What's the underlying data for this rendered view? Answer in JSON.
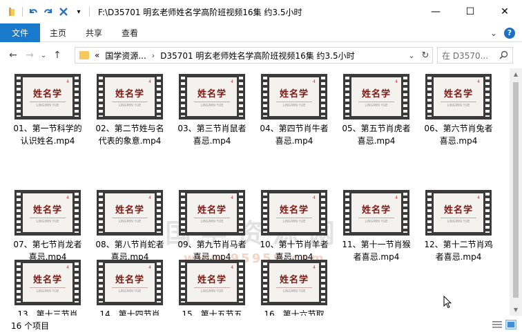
{
  "window": {
    "title": "F:\\D35701 明玄老师姓名学高阶班视频16集 约3.5小时",
    "controls": {
      "minimize": "—",
      "maximize": "☐",
      "close": "✕"
    }
  },
  "quick_access": {
    "dropdown": "▾"
  },
  "ribbon": {
    "tabs": [
      "文件",
      "主页",
      "共享",
      "查看"
    ],
    "collapse": "⌄",
    "help": "?"
  },
  "nav": {
    "back": "←",
    "forward": "→",
    "recent": "⌄",
    "up": "↑"
  },
  "address": {
    "prefix": "«",
    "crumbs": [
      "国学资源...",
      "D35701 明玄老师姓名学高阶班视频16集 约3.5小时"
    ],
    "separator": "›",
    "dropdown": "⌄",
    "refresh": "↻"
  },
  "search": {
    "placeholder": "在 D3570..."
  },
  "thumbnail": {
    "title": "姓名学",
    "subtitle": "LINGMIN YUE",
    "mark": "4"
  },
  "files": [
    "01、第一节科学的认识姓名.mp4",
    "02、第二节姓与名代表的象意.mp4",
    "03、第三节肖鼠者喜忌.mp4",
    "04、第四节肖牛者喜忌.mp4",
    "05、第五节肖虎者喜忌.mp4",
    "06、第六节肖兔者喜忌.mp4",
    "07、第七节肖龙者喜忌.mp4",
    "08、第八节肖蛇者喜忌.mp4",
    "09、第九节肖马者喜忌.mp4",
    "10、第十节肖羊者喜忌.mp4",
    "11、第十一节肖猴者喜忌.mp4",
    "12、第十二节肖鸡者喜忌.mp4",
    "13、第十三节肖",
    "14、第十四节肖",
    "15、第十五节五",
    "16、第十六节取"
  ],
  "watermark": {
    "text": "国学资源网",
    "url": "www.95959.com"
  },
  "status": {
    "count": "16 个项目"
  }
}
